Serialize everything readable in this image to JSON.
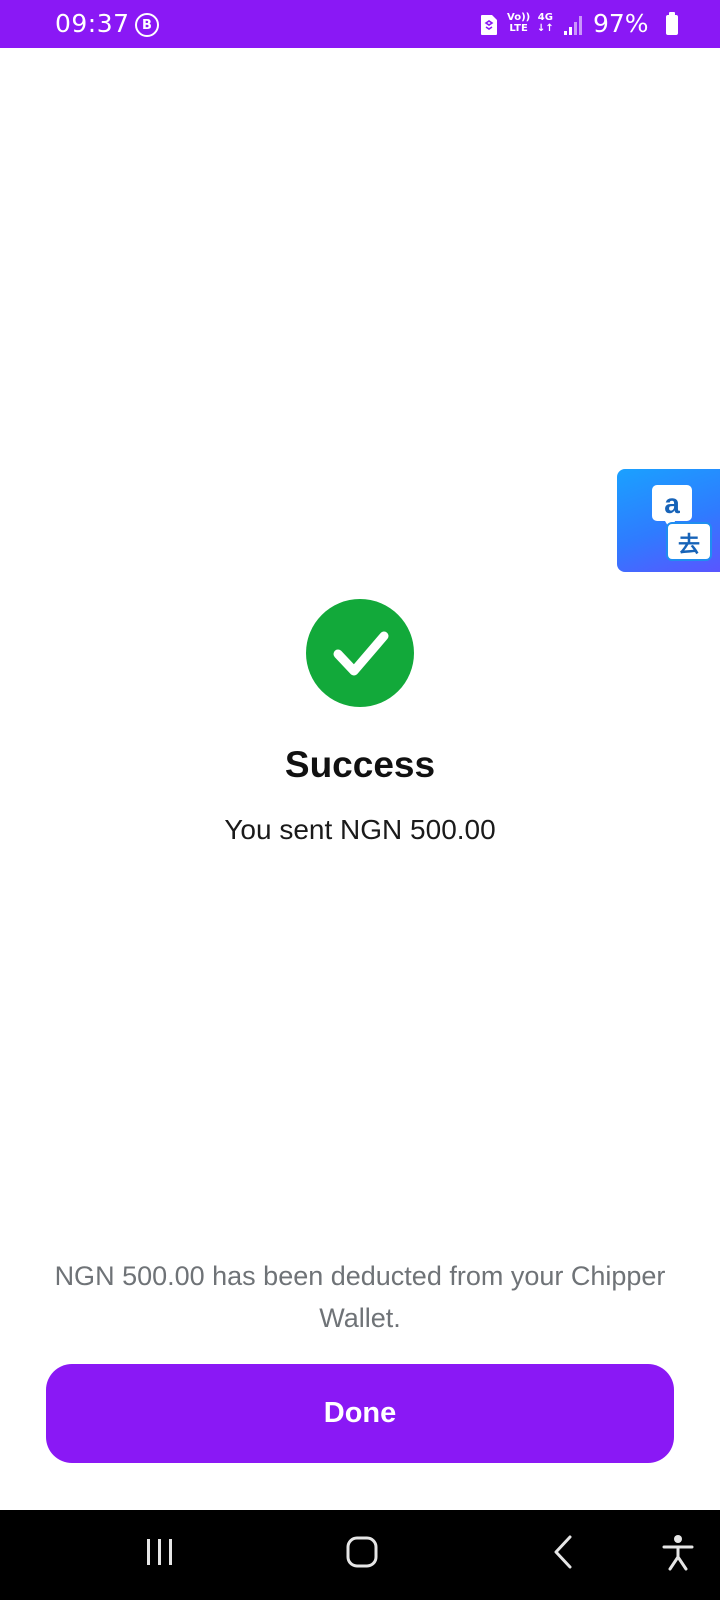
{
  "status_bar": {
    "time": "09:37",
    "b_badge": "B",
    "volte_line1": "Vo))",
    "volte_line2": "LTE",
    "network_line1": "4G",
    "network_line2": "↓↑",
    "battery_percent": "97%",
    "background_color": "#8a18f5"
  },
  "translate_button": {
    "top_glyph": "a",
    "bottom_glyph": "去"
  },
  "success": {
    "icon": "check-circle-icon",
    "icon_color": "#12a93a",
    "title": "Success",
    "subtitle": "You sent NGN 500.00"
  },
  "footer": {
    "deduction_note": "NGN 500.00 has been deducted from your Chipper Wallet.",
    "done_label": "Done",
    "accent_color": "#8a18f5"
  },
  "navigation": {
    "icons": [
      "recent-apps-icon",
      "home-icon",
      "back-icon",
      "accessibility-icon"
    ]
  }
}
